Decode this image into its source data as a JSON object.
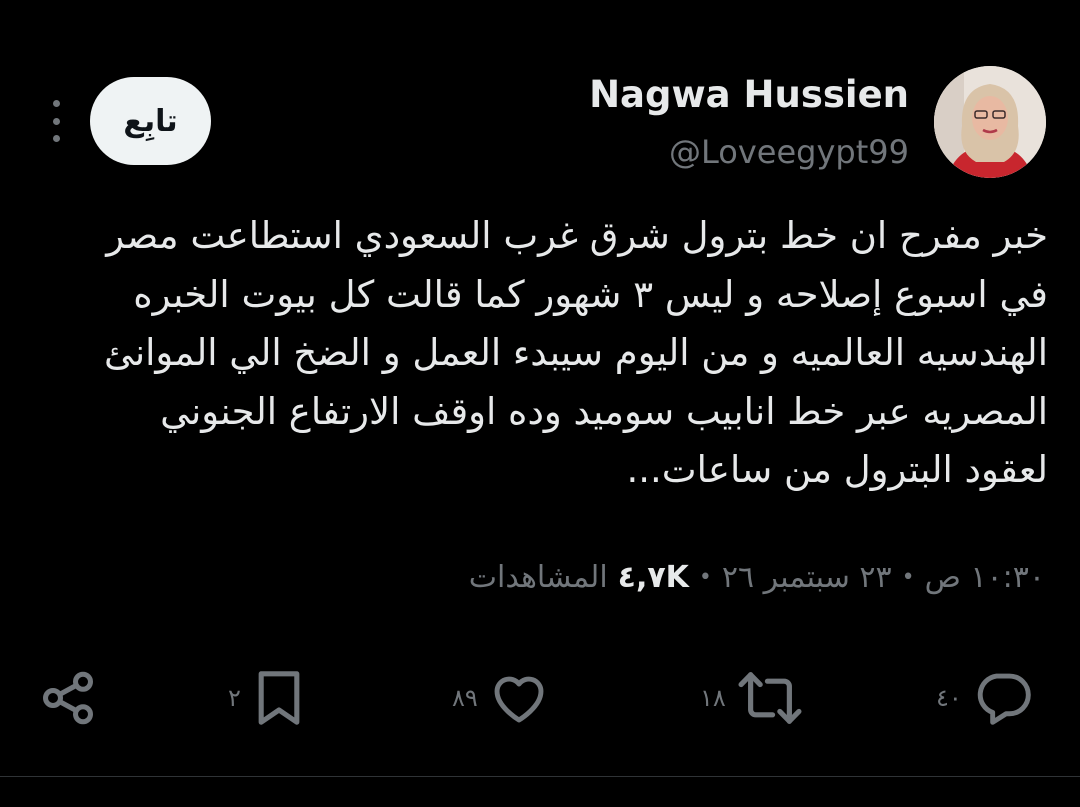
{
  "user": {
    "display_name": "Nagwa Hussien",
    "handle": "@Loveegypt99"
  },
  "follow_label": "تابِع",
  "tweet": {
    "lines": [
      "خبر مفرح  ان خط  بترول شرق غرب السعودي استطاعت مصر",
      "في اسبوع إصلاحه و ليس ٣ شهور كما قالت كل بيوت الخبره",
      "الهندسيه العالميه و من اليوم سيبدء العمل و الضخ الي الموانئ",
      "المصريه عبر خط انابيب سوميد  وده اوقف الارتفاع الجنوني",
      "لعقود البترول من ساعات..."
    ]
  },
  "meta": {
    "time": "١٠:٣٠ ص",
    "date": "٢٣ سبتمبر ٢٦",
    "views_count": "٤,٧K",
    "views_label": "المشاهدات",
    "separator": "•"
  },
  "actions": {
    "reply_count": "٤٠",
    "retweet_count": "١٨",
    "like_count": "٨٩",
    "bookmark_count": "٢"
  },
  "icons": {
    "reply": "speech-bubble-icon",
    "retweet": "retweet-arrows-icon",
    "like": "heart-icon",
    "bookmark": "bookmark-icon",
    "share": "share-nodes-icon",
    "more": "vertical-dots-icon"
  },
  "colors": {
    "background": "#000000",
    "text_primary": "#e7e9ea",
    "text_secondary": "#71767b",
    "follow_button_bg": "#eff3f4",
    "follow_button_text": "#0f1419",
    "divider": "#2f3336"
  }
}
